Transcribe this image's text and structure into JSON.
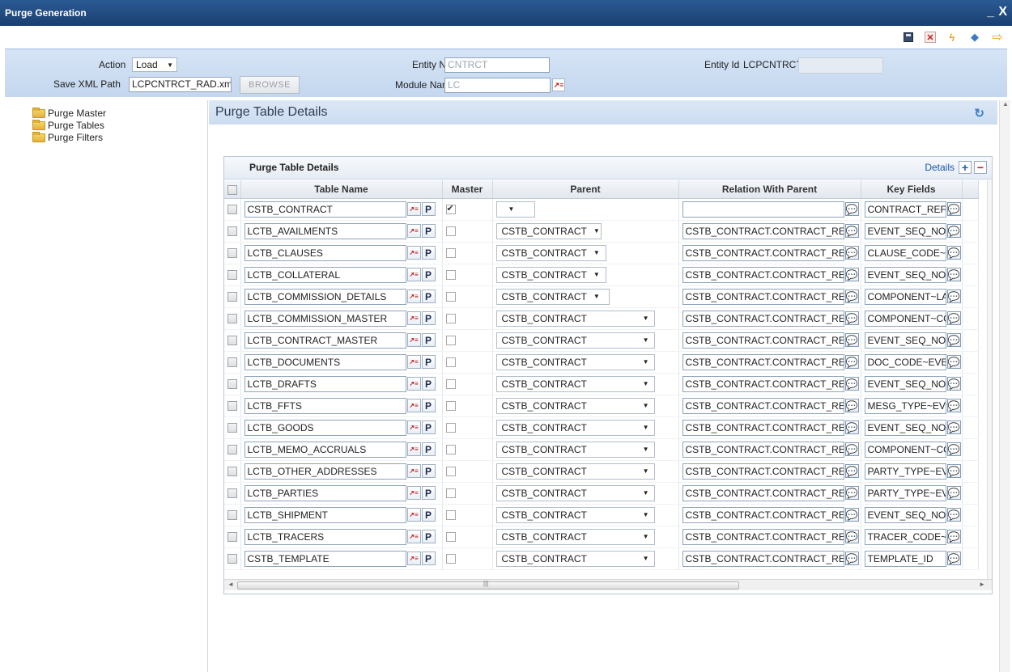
{
  "window": {
    "title": "Purge Generation",
    "minimize": "_",
    "close": "X"
  },
  "toolbar": {
    "icons": [
      "save-icon",
      "delete-icon",
      "generate-icon",
      "deploy-icon",
      "exit-icon"
    ]
  },
  "header": {
    "action_label": "Action",
    "action_value": "Load",
    "save_xml_label": "Save XML Path",
    "save_xml_value": "LCPCNTRCT_RAD.xml",
    "browse_label": "BROWSE",
    "entity_name_label": "Entity Name",
    "entity_name_value": "CNTRCT",
    "module_name_label": "Module Name",
    "module_name_value": "LC",
    "entity_id_label": "Entity Id",
    "entity_id_value": "LCPCNTRCT"
  },
  "tree": {
    "items": [
      "Purge Master",
      "Purge Tables",
      "Purge Filters"
    ]
  },
  "section": {
    "title": "Purge Table Details"
  },
  "grid": {
    "title": "Purge Table Details",
    "details_label": "Details",
    "add_label": "+",
    "remove_label": "−",
    "columns": [
      "Table Name",
      "Master",
      "Parent",
      "Relation With Parent",
      "Key Fields"
    ],
    "p_label": "P",
    "rows": [
      {
        "table": "CSTB_CONTRACT",
        "master": true,
        "parent": "",
        "relation": "",
        "keys": "CONTRACT_REF_NO"
      },
      {
        "table": "LCTB_AVAILMENTS",
        "master": false,
        "parent": "CSTB_CONTRACT",
        "relation": "CSTB_CONTRACT.CONTRACT_REF",
        "keys": "EVENT_SEQ_NO~CON"
      },
      {
        "table": "LCTB_CLAUSES",
        "master": false,
        "parent": "CSTB_CONTRACT",
        "relation": "CSTB_CONTRACT.CONTRACT_REF",
        "keys": "CLAUSE_CODE~DOC_"
      },
      {
        "table": "LCTB_COLLATERAL",
        "master": false,
        "parent": "CSTB_CONTRACT",
        "relation": "CSTB_CONTRACT.CONTRACT_REF",
        "keys": "EVENT_SEQ_NO~CON"
      },
      {
        "table": "LCTB_COMMISSION_DETAILS",
        "master": false,
        "parent": "CSTB_CONTRACT",
        "relation": "CSTB_CONTRACT.CONTRACT_REF",
        "keys": "COMPONENT~LAST_E"
      },
      {
        "table": "LCTB_COMMISSION_MASTER",
        "master": false,
        "parent": "CSTB_CONTRACT",
        "relation": "CSTB_CONTRACT.CONTRACT_REF",
        "keys": "COMPONENT~CONTR"
      },
      {
        "table": "LCTB_CONTRACT_MASTER",
        "master": false,
        "parent": "CSTB_CONTRACT",
        "relation": "CSTB_CONTRACT.CONTRACT_REF",
        "keys": "EVENT_SEQ_NO~CON"
      },
      {
        "table": "LCTB_DOCUMENTS",
        "master": false,
        "parent": "CSTB_CONTRACT",
        "relation": "CSTB_CONTRACT.CONTRACT_REF",
        "keys": "DOC_CODE~EVENT_S"
      },
      {
        "table": "LCTB_DRAFTS",
        "master": false,
        "parent": "CSTB_CONTRACT",
        "relation": "CSTB_CONTRACT.CONTRACT_REF",
        "keys": "EVENT_SEQ_NO~CON"
      },
      {
        "table": "LCTB_FFTS",
        "master": false,
        "parent": "CSTB_CONTRACT",
        "relation": "CSTB_CONTRACT.CONTRACT_REF",
        "keys": "MESG_TYPE~EVENT_S"
      },
      {
        "table": "LCTB_GOODS",
        "master": false,
        "parent": "CSTB_CONTRACT",
        "relation": "CSTB_CONTRACT.CONTRACT_REF",
        "keys": "EVENT_SEQ_NO~CON"
      },
      {
        "table": "LCTB_MEMO_ACCRUALS",
        "master": false,
        "parent": "CSTB_CONTRACT",
        "relation": "CSTB_CONTRACT.CONTRACT_REF",
        "keys": "COMPONENT~CONTR"
      },
      {
        "table": "LCTB_OTHER_ADDRESSES",
        "master": false,
        "parent": "CSTB_CONTRACT",
        "relation": "CSTB_CONTRACT.CONTRACT_REF",
        "keys": "PARTY_TYPE~EVENT_"
      },
      {
        "table": "LCTB_PARTIES",
        "master": false,
        "parent": "CSTB_CONTRACT",
        "relation": "CSTB_CONTRACT.CONTRACT_REF",
        "keys": "PARTY_TYPE~EVENT_"
      },
      {
        "table": "LCTB_SHIPMENT",
        "master": false,
        "parent": "CSTB_CONTRACT",
        "relation": "CSTB_CONTRACT.CONTRACT_REF",
        "keys": "EVENT_SEQ_NO~CON"
      },
      {
        "table": "LCTB_TRACERS",
        "master": false,
        "parent": "CSTB_CONTRACT",
        "relation": "CSTB_CONTRACT.CONTRACT_REF",
        "keys": "TRACER_CODE~EVEN"
      },
      {
        "table": "CSTB_TEMPLATE",
        "master": false,
        "parent": "CSTB_CONTRACT",
        "relation": "CSTB_CONTRACT.CONTRACT_REF",
        "keys": "TEMPLATE_ID"
      }
    ]
  }
}
